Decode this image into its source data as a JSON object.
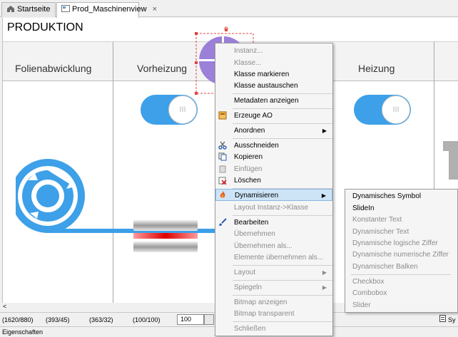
{
  "tabs": [
    {
      "label": "Startseite",
      "active": false
    },
    {
      "label": "Prod_Maschinenview",
      "active": true
    }
  ],
  "tab_close_glyph": "×",
  "canvas": {
    "title": "PRODUKTION",
    "columns": [
      "Folienabwicklung",
      "Vorheizung",
      "Heizung"
    ],
    "toggle_glyph": "III",
    "colors": {
      "accent": "#3da0e8",
      "purple": "#9b7fd9",
      "selection": "#e0443c"
    }
  },
  "context_menu": {
    "items": [
      {
        "label": "Instanz...",
        "enabled": false
      },
      {
        "label": "Klasse...",
        "enabled": false
      },
      {
        "label": "Klasse markieren",
        "enabled": true
      },
      {
        "label": "Klasse austauschen",
        "enabled": true
      },
      {
        "label": "Metadaten anzeigen",
        "enabled": true
      },
      {
        "label": "Erzeuge AO",
        "enabled": true,
        "icon": "create-ao-icon"
      },
      {
        "label": "Anordnen",
        "enabled": true,
        "submenu": true
      },
      {
        "label": "Ausschneiden",
        "enabled": true,
        "icon": "scissors-icon"
      },
      {
        "label": "Kopieren",
        "enabled": true,
        "icon": "copy-icon"
      },
      {
        "label": "Einfügen",
        "enabled": false,
        "icon": "paste-icon"
      },
      {
        "label": "Löschen",
        "enabled": true,
        "icon": "delete-icon"
      },
      {
        "label": "Dynamisieren",
        "enabled": true,
        "submenu": true,
        "highlighted": true,
        "icon": "flame-icon"
      },
      {
        "label": "Layout Instanz->Klasse",
        "enabled": false
      },
      {
        "label": "Bearbeiten",
        "enabled": true,
        "icon": "brush-icon"
      },
      {
        "label": "Übernehmen",
        "enabled": false
      },
      {
        "label": "Übernehmen als...",
        "enabled": false
      },
      {
        "label": "Elemente übernehmen als...",
        "enabled": false
      },
      {
        "label": "Layout",
        "enabled": false,
        "submenu": true
      },
      {
        "label": "Spiegeln",
        "enabled": false,
        "submenu": true
      },
      {
        "label": "Bitmap anzeigen",
        "enabled": false
      },
      {
        "label": "Bitmap transparent",
        "enabled": false
      },
      {
        "label": "Schließen",
        "enabled": false
      }
    ]
  },
  "submenu": {
    "items": [
      {
        "label": "Dynamisches Symbol",
        "enabled": true
      },
      {
        "label": "SlideIn",
        "enabled": true
      },
      {
        "label": "Konstanter Text",
        "enabled": false
      },
      {
        "label": "Dynamischer Text",
        "enabled": false
      },
      {
        "label": "Dynamische logische Ziffer",
        "enabled": false
      },
      {
        "label": "Dynamische numerische Ziffer",
        "enabled": false
      },
      {
        "label": "Dynamischer Balken",
        "enabled": false
      },
      {
        "label": "Checkbox",
        "enabled": false
      },
      {
        "label": "Combobox",
        "enabled": false
      },
      {
        "label": "Slider",
        "enabled": false
      }
    ]
  },
  "statusbar": {
    "coord1": "(1620/880)",
    "coord2": "(393/45)",
    "coord3": "(363/32)",
    "coord4": "(100/100)",
    "zoom": "100",
    "right_label": "Sy"
  },
  "bottombar": {
    "label": "Eigenschaften"
  }
}
